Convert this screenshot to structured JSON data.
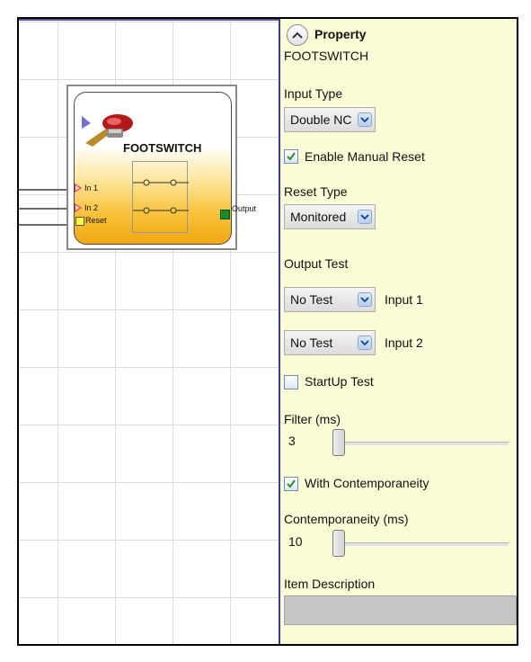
{
  "canvas": {
    "block": {
      "title": "FOOTSWITCH",
      "inputs": [
        "In 1",
        "In 2"
      ],
      "reset_label": "Reset",
      "output_label": "Output"
    }
  },
  "panel": {
    "header": "Property",
    "component_name": "FOOTSWITCH",
    "input_type": {
      "label": "Input Type",
      "value": "Double NC"
    },
    "enable_manual_reset": {
      "label": "Enable Manual Reset",
      "checked": true
    },
    "reset_type": {
      "label": "Reset Type",
      "value": "Monitored"
    },
    "output_test": {
      "label": "Output Test",
      "rows": [
        {
          "value": "No Test",
          "label": "Input 1"
        },
        {
          "value": "No Test",
          "label": "Input 2"
        }
      ]
    },
    "startup_test": {
      "label": "StartUp Test",
      "checked": false
    },
    "filter": {
      "label": "Filter (ms)",
      "value": "3"
    },
    "with_contemporaneity": {
      "label": "With Contemporaneity",
      "checked": true
    },
    "contemporaneity": {
      "label": "Contemporaneity (ms)",
      "value": "10"
    },
    "item_description": {
      "label": "Item Description",
      "value": ""
    }
  },
  "colors": {
    "panel_bg": "#fbfbd6",
    "block_gradient_bottom": "#f2a712",
    "output_port": "#1a8a2a",
    "input_port": "#e4303a",
    "checkmark": "#2f8a2f"
  },
  "icons": [
    "collapse-up-icon",
    "footswitch-icon",
    "dropdown-chevron-icon",
    "checkmark-icon"
  ]
}
